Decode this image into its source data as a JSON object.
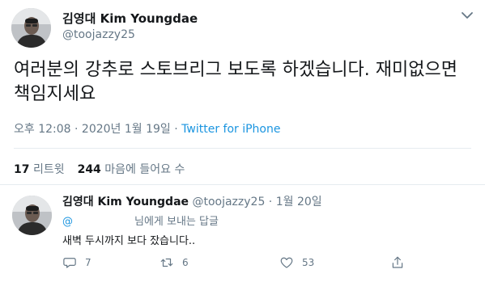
{
  "tweet": {
    "author_name": "김영대 Kim Youngdae",
    "author_handle": "@toojazzy25",
    "text": "여러분의 강추로 스토브리그 보도록 하겠습니다. 재미없으면 책임지세요",
    "time": "오후 12:08 · 2020년 1월 19일 · ",
    "source": "Twitter for iPhone",
    "retweets_count": "17",
    "retweets_label": "리트윗",
    "likes_count": "244",
    "likes_label": "마음에 들어요 수"
  },
  "reply": {
    "author_name": "김영대 Kim Youngdae",
    "meta": " @toojazzy25 · 1월 20일",
    "mention": "@",
    "reply_to_label": "님에게 보내는 답글",
    "text": "새벽 두시까지 보다 잤습니다..",
    "reply_count": "7",
    "retweet_count": "6",
    "like_count": "53"
  },
  "icons": {
    "caret": "chevron-down-icon",
    "reply": "comment-bubble-icon",
    "retweet": "retweet-icon",
    "like": "heart-icon",
    "share": "share-icon"
  },
  "colors": {
    "text": "#14171a",
    "muted": "#657786",
    "link": "#1b95e0",
    "divider": "#e6ecf0"
  }
}
